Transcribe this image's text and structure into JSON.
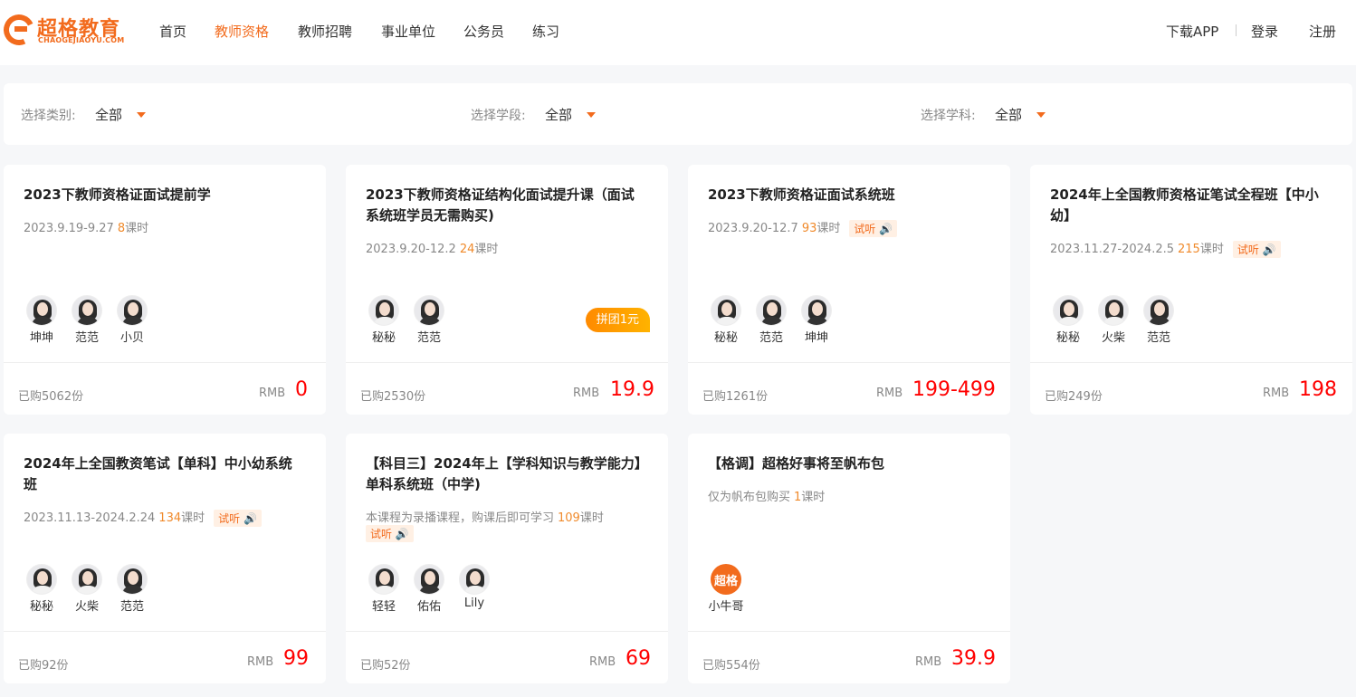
{
  "header": {
    "logo_cn": "超格教育",
    "logo_en": "CHAOGEJIAOYU.COM",
    "nav": [
      "首页",
      "教师资格",
      "教师招聘",
      "事业单位",
      "公务员",
      "练习"
    ],
    "active_nav": "教师资格",
    "download": "下载APP",
    "login": "登录",
    "register": "注册",
    "accent_color": "#f26b1d"
  },
  "filters": [
    {
      "label": "选择类别:",
      "value": "全部"
    },
    {
      "label": "选择学段:",
      "value": "全部"
    },
    {
      "label": "选择学科:",
      "value": "全部"
    }
  ],
  "cards": [
    {
      "title": "2023下教师资格证面试提前学",
      "date": "2023.9.19-9.27",
      "hours": "8",
      "hours_unit": "课时",
      "trial": "",
      "teachers": [
        "坤坤",
        "范范",
        "小贝"
      ],
      "bought": "已购5062份",
      "rmb": "RMB",
      "price": "0",
      "badge": ""
    },
    {
      "title": "2023下教师资格证结构化面试提升课（面试系统班学员无需购买)",
      "date": "2023.9.20-12.2",
      "hours": "24",
      "hours_unit": "课时",
      "trial": "",
      "teachers": [
        "秘秘",
        "范范"
      ],
      "bought": "已购2530份",
      "rmb": "RMB",
      "price": "19.9",
      "badge": "拼团1元"
    },
    {
      "title": "2023下教师资格证面试系统班",
      "date": "2023.9.20-12.7",
      "hours": "93",
      "hours_unit": "课时",
      "trial": "试听",
      "teachers": [
        "秘秘",
        "范范",
        "坤坤"
      ],
      "bought": "已购1261份",
      "rmb": "RMB",
      "price": "199-499",
      "badge": ""
    },
    {
      "title": "2024年上全国教师资格证笔试全程班【中小幼】",
      "date": "2023.11.27-2024.2.5",
      "hours": "215",
      "hours_unit": "课时",
      "trial": "试听",
      "teachers": [
        "秘秘",
        "火柴",
        "范范"
      ],
      "bought": "已购249份",
      "rmb": "RMB",
      "price": "198",
      "badge": ""
    },
    {
      "title": "2024年上全国教资笔试【单科】中小幼系统班",
      "date": "2023.11.13-2024.2.24",
      "hours": "134",
      "hours_unit": "课时",
      "trial": "试听",
      "teachers": [
        "秘秘",
        "火柴",
        "范范"
      ],
      "bought": "已购92份",
      "rmb": "RMB",
      "price": "99",
      "badge": ""
    },
    {
      "title": "【科目三】2024年上【学科知识与教学能力】单科系统班（中学)",
      "date": "本课程为录播课程，购课后即可学习",
      "hours": "109",
      "hours_unit": "课时",
      "trial": "试听",
      "teachers": [
        "轻轻",
        "佑佑",
        "Lily"
      ],
      "bought": "已购52份",
      "rmb": "RMB",
      "price": "69",
      "badge": ""
    },
    {
      "title": "【格调】超格好事将至帆布包",
      "date": "仅为帆布包购买",
      "hours": "1",
      "hours_unit": "课时",
      "trial": "",
      "teachers": [
        "小牛哥"
      ],
      "teacher_logo": "超格",
      "bought": "已购554份",
      "rmb": "RMB",
      "price": "39.9",
      "badge": ""
    }
  ]
}
